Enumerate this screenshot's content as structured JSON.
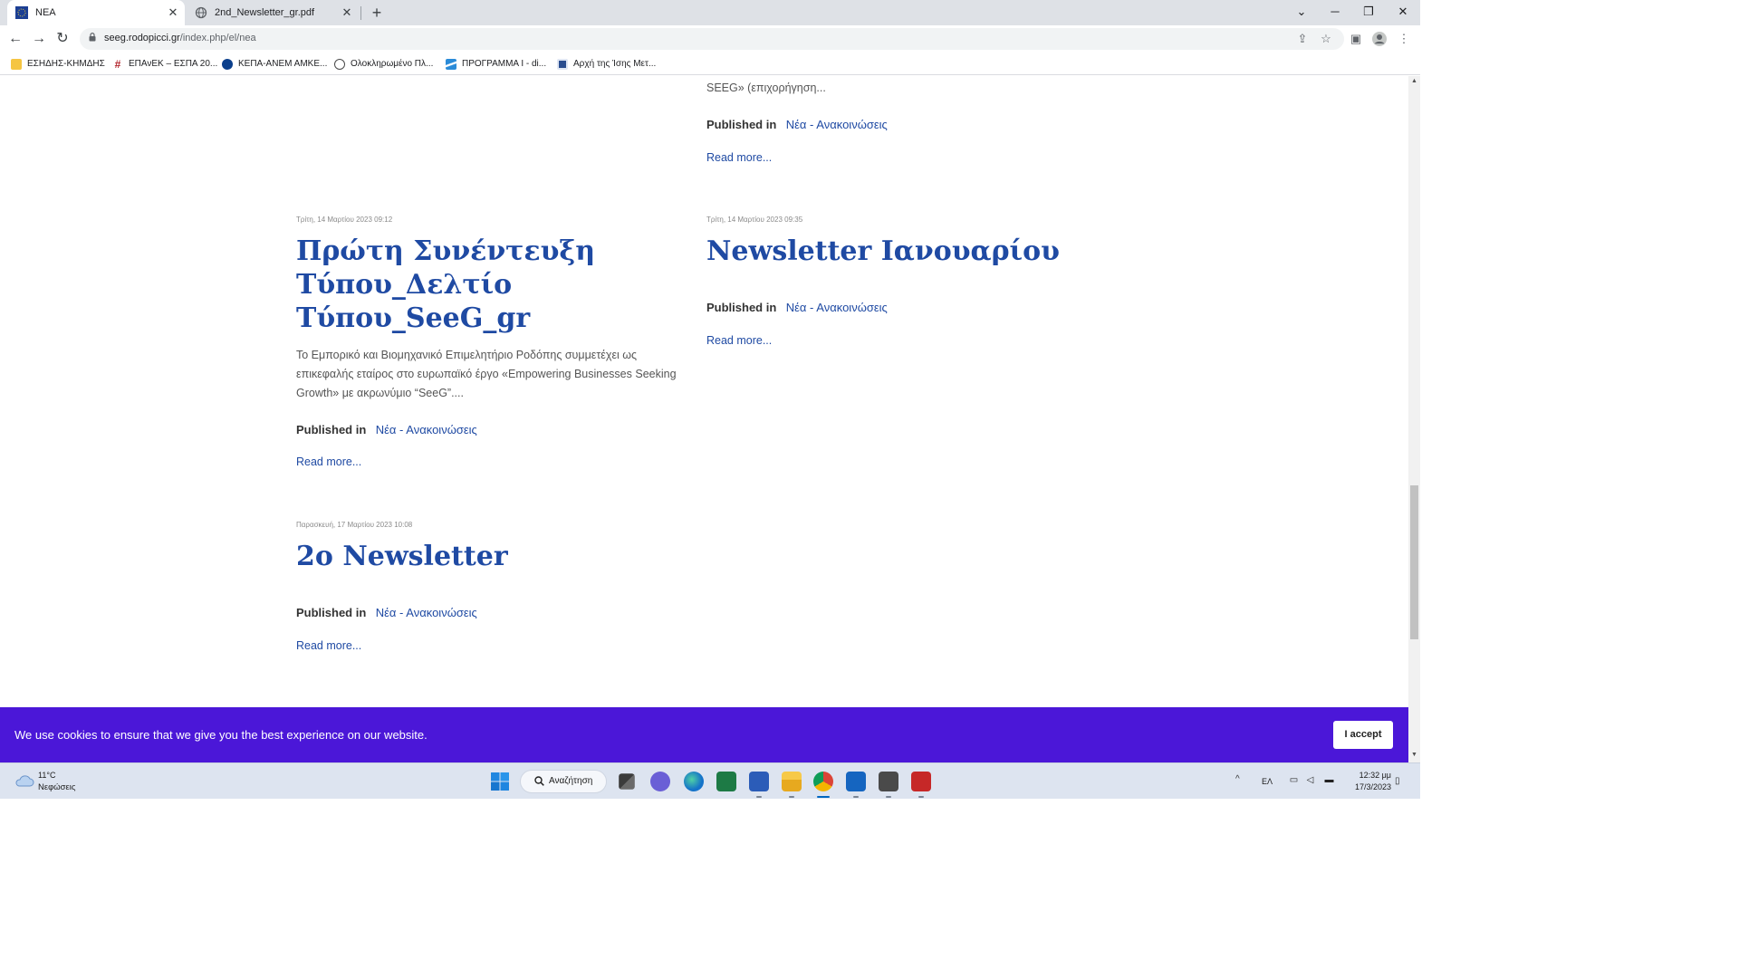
{
  "browser": {
    "tabs": [
      {
        "title": "ΝΕΑ",
        "active": true
      },
      {
        "title": "2nd_Newsletter_gr.pdf",
        "active": false
      }
    ],
    "new_tab": "+",
    "window_controls": {
      "tab_search": "⌄",
      "minimize": "─",
      "restore": "❐",
      "close": "✕"
    },
    "url_host": "seeg.rodopicci.gr",
    "url_path": "/index.php/el/nea",
    "bookmarks": [
      {
        "label": "ΕΣΗΔΗΣ-ΚΗΜΔΗΣ",
        "icon": "folder-icon",
        "color": "#f5c542"
      },
      {
        "label": "ΕΠΑνΕΚ – ΕΣΠΑ 20...",
        "icon": "hash-icon",
        "color": "#b3262d"
      },
      {
        "label": "ΚΕΠΑ-ΑΝΕΜ ΑΜΚΕ...",
        "icon": "dot-icon",
        "color": "#0b3f8c"
      },
      {
        "label": "Ολοκληρωμένο Πλ...",
        "icon": "globe-icon",
        "color": "#4a4a4a"
      },
      {
        "label": "ΠΡΟΓΡΑΜΜΑ Ι - di...",
        "icon": "swoosh-icon",
        "color": "#2a8bd8"
      },
      {
        "label": "Αρχή της Ίσης Μετ...",
        "icon": "site-icon",
        "color": "#2a4d8f"
      }
    ]
  },
  "articles": {
    "top_right_partial": {
      "intro_tail": "SEEG» (επιχορήγηση...",
      "published_label": "Published in",
      "category": "Νέα - Ανακοινώσεις",
      "read_more": "Read more..."
    },
    "left_1": {
      "date": "Τρίτη, 14 Μαρτίου 2023 09:12",
      "title_lines": [
        "Πρώτη Συνέντευξη",
        "Τύπου_Δελτίο",
        "Τύπου_SeeG_gr"
      ],
      "intro_lines": [
        "Το Εμπορικό και Βιομηχανικό Επιμελητήριο Ροδόπης συμμετέχει ως",
        "επικεφαλής εταίρος στο ευρωπαϊκό έργο «Empowering Businesses Seeking",
        "Growth» με ακρωνύμιο “SeeG”...."
      ],
      "published_label": "Published in",
      "category": "Νέα - Ανακοινώσεις",
      "read_more": "Read more..."
    },
    "right_1": {
      "date": "Τρίτη, 14 Μαρτίου 2023 09:35",
      "title": "Newsletter Ιανουαρίου",
      "published_label": "Published in",
      "category": "Νέα - Ανακοινώσεις",
      "read_more": "Read more..."
    },
    "left_2": {
      "date": "Παρασκευή, 17 Μαρτίου 2023 10:08",
      "title": "2ο Newsletter",
      "published_label": "Published in",
      "category": "Νέα - Ανακοινώσεις",
      "read_more": "Read more..."
    }
  },
  "cookie_bar": {
    "message": "We use cookies to ensure that we give you the best experience on our website.",
    "accept": "I accept",
    "color": "#4b17d8"
  },
  "taskbar": {
    "weather_temp": "11°C",
    "weather_condition": "Νεφώσεις",
    "search_placeholder": "Αναζήτηση",
    "language": "ΕΛ",
    "time": "12:32 μμ",
    "date": "17/3/2023",
    "apps": [
      "start",
      "search",
      "task-view",
      "teams",
      "edge",
      "excel",
      "word",
      "file-explorer",
      "chrome",
      "outlook",
      "camera",
      "acrobat"
    ]
  }
}
